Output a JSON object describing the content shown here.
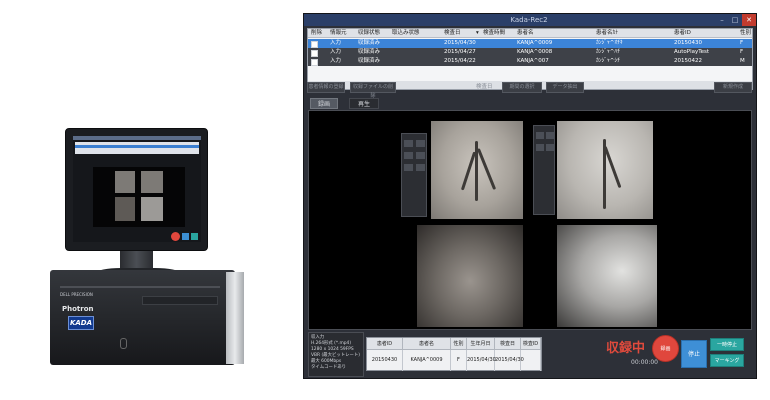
{
  "product": {
    "tower_brand": "DELL PRECISION",
    "vendor_logo": "Photron",
    "product_logo": "KADA"
  },
  "window": {
    "title": "Kada-Rec2",
    "controls": [
      "–",
      "□",
      "✕"
    ]
  },
  "list": {
    "columns": [
      "削除",
      "情報元",
      "収録状態",
      "取込み状態",
      "検査日",
      "検査時間",
      "患者名",
      "患者名ｶﾅ",
      "患者ID",
      "性別"
    ],
    "rows": [
      {
        "info": "入力",
        "rec_status": "収録済み",
        "date": "2015/04/30",
        "name": "KANJA^0009",
        "kana": "ｶﾝｼﾞｬ^ｵﾁｷ",
        "pid": "20150430",
        "sex": "F",
        "selected": true
      },
      {
        "info": "入力",
        "rec_status": "収録済み",
        "date": "2015/04/27",
        "name": "KANJA^0008",
        "kana": "ｶﾝｼﾞｬ^ﾊﾁ",
        "pid": "AutoPlayTest",
        "sex": "F",
        "selected": false
      },
      {
        "info": "入力",
        "rec_status": "収録済み",
        "date": "2015/04/22",
        "name": "KANJA^007",
        "kana": "ｶﾝｼﾞｬ^ｼﾁ",
        "pid": "20150422",
        "sex": "M",
        "selected": false
      }
    ]
  },
  "toolbar": {
    "btn1": "患者情報の登録",
    "btn2": "収録ファイルの削除",
    "date_label": "検査日",
    "btn3": "期間の選択",
    "btn4": "データ抽出",
    "btn5": "新規作成"
  },
  "tabs": [
    "録画",
    "再生"
  ],
  "info_panel": [
    "収入力",
    "H.264形式 (*.mp4)",
    "1280 x 1024 59FPS",
    "VBR (最大ビットレート)",
    "最大 600Mbps",
    "タイムコードあり"
  ],
  "patient_table": {
    "headers": [
      "患者ID",
      "患者名",
      "性別",
      "生年月日",
      "検査日",
      "検査ID"
    ],
    "values": [
      "20150430",
      "KANJA^0009",
      "F",
      "2015/04/30",
      "2015/04/30",
      ""
    ]
  },
  "status": {
    "recording": "収録中",
    "timer": "00:00:00"
  },
  "buttons": {
    "record": "録画",
    "stop": "停止",
    "pause": "一時停止",
    "marking": "マーキング"
  },
  "colors": {
    "accent_blue": "#3c84d8",
    "record_red": "#e0473d",
    "teal": "#2aa6a0"
  }
}
